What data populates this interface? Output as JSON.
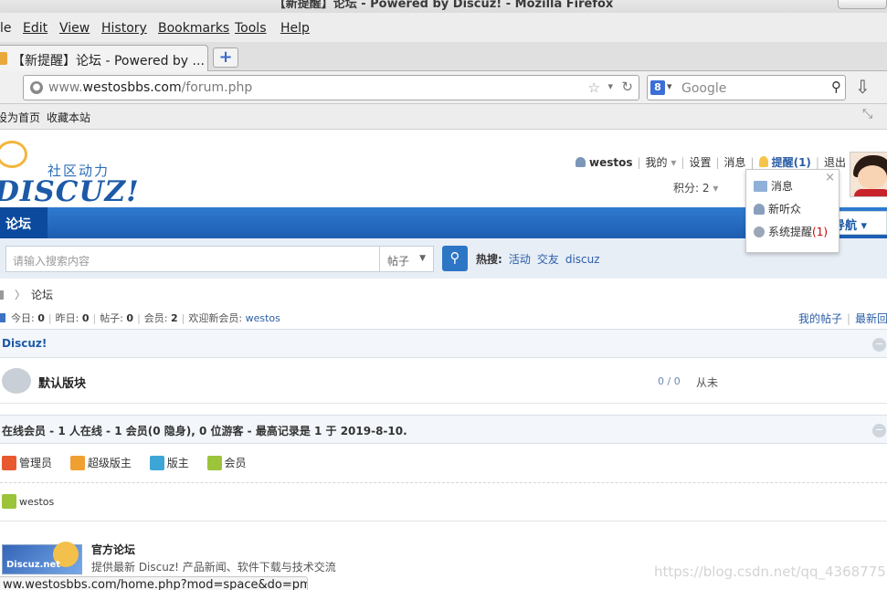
{
  "window": {
    "title": "【新提醒】论坛 - Powered by Discuz! - Mozilla Firefox"
  },
  "menu": [
    "le",
    "Edit",
    "View",
    "History",
    "Bookmarks",
    "Tools",
    "Help"
  ],
  "tab": {
    "label": "【新提醒】论坛 - Powered by ...",
    "new_tab": "+"
  },
  "address": {
    "prefix": "www.",
    "domain": "westosbbs.com",
    "path": "/forum.php"
  },
  "search_engine": {
    "placeholder": "Google"
  },
  "bookmarks": [
    "设为首页",
    "收藏本站"
  ],
  "site": {
    "logo_cn": "社区动力",
    "logo_en": "DISCUZ!",
    "user": {
      "name": "westos",
      "my": "我的",
      "settings": "设置",
      "messages": "消息",
      "reminders": "提醒(1)",
      "logout": "退出",
      "credits": "积分: 2"
    },
    "nav": {
      "current": "论坛",
      "quick_nav": "导航"
    },
    "search": {
      "placeholder": "请输入搜索内容",
      "type": "帖子",
      "hot_label": "热搜:",
      "hot": [
        "活动",
        "交友",
        "discuz"
      ]
    },
    "breadcrumb": "论坛",
    "stats": {
      "today_label": "今日:",
      "today": "0",
      "yesterday_label": "昨日:",
      "yesterday": "0",
      "posts_label": "帖子:",
      "posts": "0",
      "members_label": "会员:",
      "members": "2",
      "welcome": "欢迎新会员:",
      "new_member": "westos"
    },
    "links": {
      "my_posts": "我的帖子",
      "latest": "最新回"
    },
    "category": {
      "title": "Discuz!",
      "collapse": "−"
    },
    "forum": {
      "name": "默认版块",
      "counts": "0 / 0",
      "last": "从未"
    },
    "online": {
      "header": "在线会员 - 1 人在线 - 1 会员(0 隐身), 0 位游客 - 最高记录是 1 于 2019-8-10.",
      "legend": [
        "管理员",
        "超级版主",
        "版主",
        "会员"
      ],
      "users": [
        "westos"
      ]
    },
    "official": {
      "badge": "Discuz.net",
      "title": "官方论坛",
      "desc": "提供最新 Discuz! 产品新闻、软件下载与技术交流"
    },
    "popup": {
      "items": [
        "消息",
        "新听众",
        "系统提醒"
      ],
      "sys_count": "(1)",
      "close": "×"
    }
  },
  "status_url": "ww.westosbbs.com/home.php?mod=space&do=pm",
  "watermark": "https://blog.csdn.net/qq_43687755",
  "colors": {
    "admin": "#e9592f",
    "super_mod": "#f0a030",
    "mod": "#3ea6d6",
    "member": "#9bc43a"
  }
}
